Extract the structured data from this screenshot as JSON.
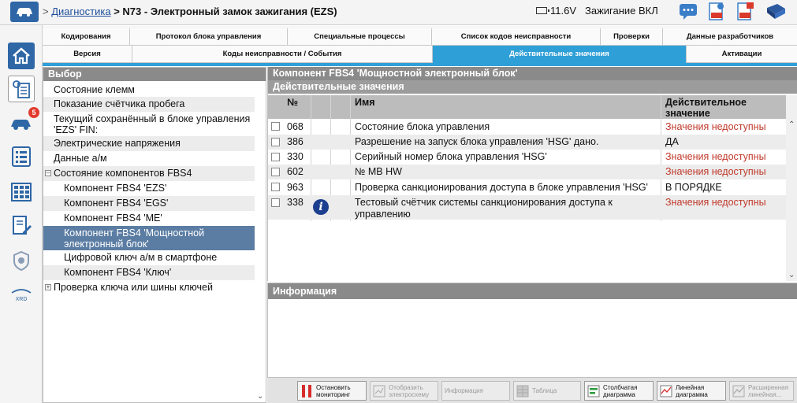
{
  "header": {
    "breadcrumb_sep": ">",
    "breadcrumb_root": "Диагностика",
    "breadcrumb_current": "> N73 - Электронный замок зажигания (EZS)",
    "battery_voltage": "11.6V",
    "ignition": "Зажигание ВКЛ"
  },
  "rail": {
    "badge_count": "5",
    "xrd_label": "XRD"
  },
  "tabs": {
    "row1": [
      "Кодирования",
      "Протокол блока управления",
      "Специальные процессы",
      "Список кодов неисправности",
      "Проверки",
      "Данные разработчиков"
    ],
    "row2": [
      "Версия",
      "Коды неисправности / События",
      "Действительные значения",
      "Активации"
    ],
    "active": "Действительные значения"
  },
  "selection": {
    "title": "Выбор",
    "items": [
      "Состояние клемм",
      "Показание счётчика пробега",
      "Текущий сохранённый в блоке управления 'EZS' FIN:",
      "Электрические напряжения",
      "Данные а/м",
      "Состояние компонентов FBS4",
      "Компонент FBS4 'EZS'",
      "Компонент FBS4 'EGS'",
      "Компонент FBS4 'ME'",
      "Компонент FBS4 'Мощностной электронный блок'",
      "Цифровой ключ а/м в смартфоне",
      "Компонент FBS4 'Ключ'",
      "Проверка ключа или шины ключей"
    ],
    "expand_minus": "–",
    "expand_plus": "+"
  },
  "values": {
    "title": "Компонент FBS4 'Мощностной электронный блок'",
    "subtitle": "Действительные значения",
    "columns": {
      "no": "№",
      "name": "Имя",
      "value": "Действительное значение"
    },
    "rows": [
      {
        "no": "068",
        "name": "Состояние блока управления",
        "value": "Значения недоступны",
        "info": false
      },
      {
        "no": "386",
        "name": "Разрешение на запуск блока управления 'HSG' дано.",
        "value": "ДА",
        "info": false
      },
      {
        "no": "330",
        "name": "Серийный номер блока управления 'HSG'",
        "value": "Значения недоступны",
        "info": false
      },
      {
        "no": "602",
        "name": "№ MB HW",
        "value": "Значения недоступны",
        "info": false
      },
      {
        "no": "963",
        "name": "Проверка санкционирования доступа в блоке управления 'HSG'",
        "value": "В ПОРЯДКЕ",
        "info": false
      },
      {
        "no": "338",
        "name": "Тестовый счётчик системы санкционирования доступа к управлению",
        "value": "Значения недоступны",
        "info": true
      }
    ],
    "info_glyph": "i"
  },
  "info_panel": {
    "title": "Информация"
  },
  "toolbar": {
    "stop_monitoring": "Остановить мониторинг",
    "show_diagram": "Отобразить электросхему",
    "information": "Информация",
    "table": "Таблица",
    "bar_chart": "Столбчатая диаграмма",
    "line_chart": "Линейная диаграмма",
    "extended_line": "Расширенная линейная..."
  },
  "colors": {
    "accent": "#2f9fd8",
    "nav_blue": "#2e66a6",
    "selected": "#5b7da3",
    "error_text": "#c0392b"
  }
}
